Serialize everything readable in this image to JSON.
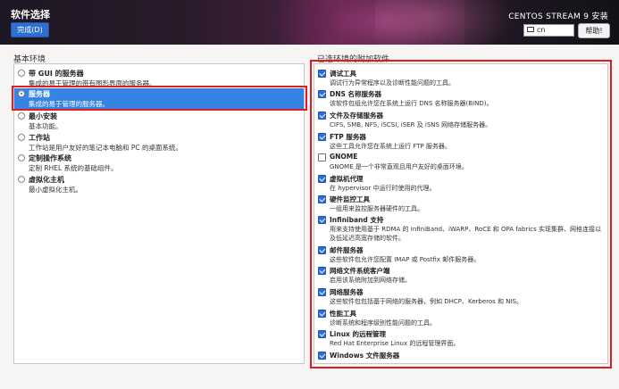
{
  "header": {
    "title": "软件选择",
    "done_label": "完成(D)",
    "product": "CENTOS STREAM 9 安装",
    "keyboard": "cn",
    "help_label": "帮助!"
  },
  "base_environment": {
    "label": "基本环境",
    "items": [
      {
        "name": "带 GUI 的服务器",
        "desc": "集成的易于管理的带有图形界面的服务器。",
        "selected": false
      },
      {
        "name": "服务器",
        "desc": "集成的易于管理的服务器。",
        "selected": true
      },
      {
        "name": "最小安装",
        "desc": "基本功能。",
        "selected": false
      },
      {
        "name": "工作站",
        "desc": "工作站是用户友好的笔记本电脑和 PC 的桌面系统。",
        "selected": false
      },
      {
        "name": "定制操作系统",
        "desc": "定制 RHEL 系统的基础组件。",
        "selected": false
      },
      {
        "name": "虚拟化主机",
        "desc": "最小虚拟化主机。",
        "selected": false
      }
    ]
  },
  "addons": {
    "label": "已选环境的附加软件",
    "items": [
      {
        "name": "调试工具",
        "desc": "调试行为异常程序以及诊断性能问题的工具。",
        "checked": true
      },
      {
        "name": "DNS 名称服务器",
        "desc": "该软件包组允许您在系统上运行 DNS 名称服务器(BIND)。",
        "checked": true
      },
      {
        "name": "文件及存储服务器",
        "desc": "CIFS, SMB, NFS, iSCSI, iSER 及 iSNS 网络存储服务器。",
        "checked": true
      },
      {
        "name": "FTP 服务器",
        "desc": "这些工具允许您在系统上运行 FTP 服务器。",
        "checked": true
      },
      {
        "name": "GNOME",
        "desc": "GNOME 是一个非常直观且用户友好的桌面环境。",
        "checked": false
      },
      {
        "name": "虚拟机代理",
        "desc": "在 hypervisor 中运行时使用的代理。",
        "checked": true
      },
      {
        "name": "硬件监控工具",
        "desc": "一组用来监控服务器硬件的工具。",
        "checked": true
      },
      {
        "name": "Infiniband 支持",
        "desc": "用来支持使用基于 RDMA 的 InfiniBand、iWARP、RoCE 和 OPA fabrics 实现集群、网格连接以及低延迟高宽存储的软件。",
        "checked": true
      },
      {
        "name": "邮件服务器",
        "desc": "这些软件包允许您配置 IMAP 或 Postfix 邮件服务器。",
        "checked": true
      },
      {
        "name": "网络文件系统客户端",
        "desc": "启用该系统附加到网络存储。",
        "checked": true
      },
      {
        "name": "网络服务器",
        "desc": "这些软件包包括基于网络的服务器，例如 DHCP、Kerberos 和 NIS。",
        "checked": true
      },
      {
        "name": "性能工具",
        "desc": "诊断系统和程序级别性能问题的工具。",
        "checked": true
      },
      {
        "name": "Linux 的远程管理",
        "desc": "Red Hat Enterprise Linux 的远程管理界面。",
        "checked": true
      },
      {
        "name": "Windows 文件服务器",
        "desc": "",
        "checked": true
      }
    ]
  }
}
